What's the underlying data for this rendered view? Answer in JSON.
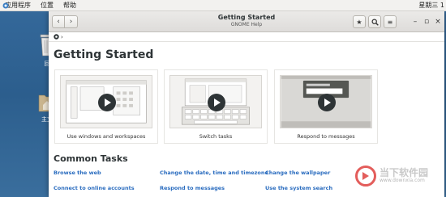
{
  "top_panel": {
    "menus": [
      "应用程序",
      "位置",
      "帮助"
    ],
    "clock": "星期三 1"
  },
  "desktop": {
    "icons": [
      {
        "label": "回",
        "icon": "trash-icon"
      },
      {
        "label": "主文",
        "icon": "home-folder-icon"
      }
    ]
  },
  "window": {
    "title": "Getting Started",
    "subtitle": "GNOME Help",
    "buttons": {
      "back": "‹",
      "forward": "›",
      "bookmark": "★",
      "search": "search-icon",
      "menu": "≡"
    },
    "controls": {
      "minimize": "–",
      "maximize": "▫",
      "close": "×"
    }
  },
  "pathbar": {
    "crumb_icon": "help-icon",
    "separator": "›"
  },
  "page": {
    "title": "Getting Started",
    "videos": [
      {
        "caption": "Use windows and workspaces"
      },
      {
        "caption": "Switch tasks"
      },
      {
        "caption": "Respond to messages"
      }
    ],
    "common_tasks_title": "Common Tasks",
    "tasks": [
      "Browse the web",
      "Change the date, time and timezone",
      "Change the wallpaper",
      "Connect to online accounts",
      "Respond to messages",
      "Use the system search"
    ]
  },
  "watermark": {
    "text": "当下软件园",
    "url": "www.downxia.com"
  },
  "colors": {
    "link": "#2a6cbf",
    "heading": "#2e3436",
    "desktop": "#2b5f8e"
  }
}
